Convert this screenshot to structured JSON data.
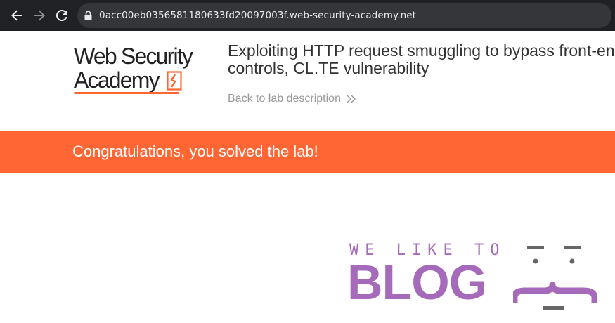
{
  "browser": {
    "url": "0acc00eb0356581180633fd20097003f.web-security-academy.net"
  },
  "header": {
    "logo_line1": "Web Security",
    "logo_line2": "Academy",
    "lab_title_line1": "Exploiting HTTP request smuggling to bypass front-end security",
    "lab_title_line2": "controls, CL.TE vulnerability",
    "back_link": "Back to lab description"
  },
  "banner": {
    "message": "Congratulations, you solved the lab!"
  },
  "blog_logo": {
    "tagline": "WE LIKE TO",
    "word": "BLOG"
  },
  "colors": {
    "toolbar_bg": "#202124",
    "omnibox_bg": "#35363a",
    "accent_orange": "#ff6633",
    "blog_purple": "#a56ab9",
    "face_gray": "#666666"
  },
  "icons": [
    "back-arrow-icon",
    "forward-arrow-icon",
    "reload-icon",
    "lock-icon",
    "academy-logo-icon",
    "double-chevron-right-icon",
    "blog-face-icon"
  ]
}
